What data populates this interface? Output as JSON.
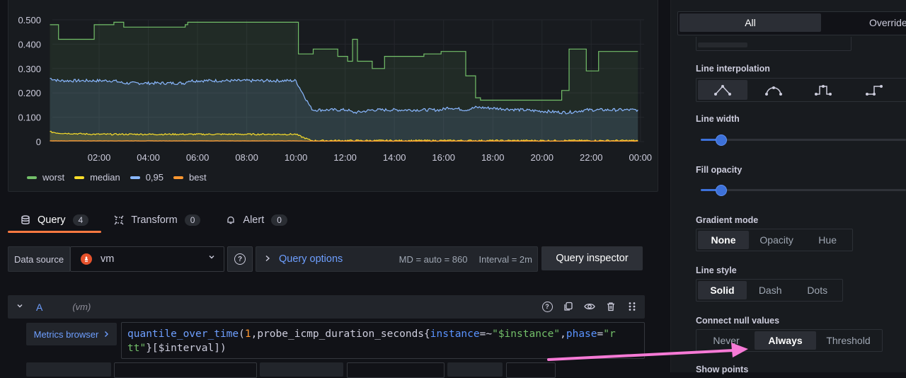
{
  "chart": {
    "legend": [
      {
        "name": "worst",
        "color": "#73bf69"
      },
      {
        "name": "median",
        "color": "#fade2a"
      },
      {
        "name": "0,95",
        "color": "#8ab8ff"
      },
      {
        "name": "best",
        "color": "#ff9830"
      }
    ]
  },
  "chart_data": {
    "type": "line",
    "y_ticks": [
      "0.500",
      "0.400",
      "0.300",
      "0.200",
      "0.100",
      "0"
    ],
    "x_ticks": [
      "02:00",
      "04:00",
      "06:00",
      "08:00",
      "10:00",
      "12:00",
      "14:00",
      "16:00",
      "18:00",
      "20:00",
      "22:00",
      "00:00"
    ],
    "ylim": [
      0,
      0.5
    ],
    "x_hours": [
      0.0,
      0.35,
      1.8,
      2.6,
      3.0,
      5.5,
      5.6,
      7.6,
      10.0,
      10.1,
      10.6,
      10.7,
      11.7,
      12.1,
      12.3,
      12.5,
      13.1,
      13.6,
      14.2,
      14.6,
      15.2,
      15.9,
      16.2,
      16.9,
      17.3,
      17.5,
      20.8,
      21.1,
      21.8,
      22.3,
      23.5,
      23.9
    ],
    "series": [
      {
        "name": "worst",
        "values": [
          0.48,
          0.42,
          0.48,
          0.49,
          0.47,
          0.48,
          0.49,
          0.49,
          0.49,
          0.36,
          0.36,
          0.38,
          0.35,
          0.33,
          0.42,
          0.33,
          0.3,
          0.35,
          0.35,
          0.35,
          0.36,
          0.37,
          0.37,
          0.27,
          0.18,
          0.17,
          0.21,
          0.38,
          0.29,
          0.37,
          0.37,
          0.37
        ]
      },
      {
        "name": "0,95",
        "values": [
          0.26,
          0.25,
          0.25,
          0.25,
          0.24,
          0.24,
          0.25,
          0.25,
          0.25,
          0.23,
          0.14,
          0.13,
          0.13,
          0.13,
          0.12,
          0.12,
          0.13,
          0.13,
          0.13,
          0.13,
          0.13,
          0.13,
          0.14,
          0.13,
          0.14,
          0.14,
          0.12,
          0.12,
          0.13,
          0.13,
          0.13,
          0.13
        ]
      },
      {
        "name": "median",
        "values": [
          0.04,
          0.035,
          0.03,
          0.03,
          0.03,
          0.03,
          0.03,
          0.03,
          0.03,
          0.025,
          0.005,
          0.004,
          0.004,
          0.004,
          0.004,
          0.004,
          0.004,
          0.004,
          0.004,
          0.004,
          0.004,
          0.004,
          0.004,
          0.004,
          0.004,
          0.004,
          0.004,
          0.004,
          0.004,
          0.004,
          0.004,
          0.004
        ]
      },
      {
        "name": "best",
        "values": [
          0.003,
          0.003,
          0.003,
          0.003,
          0.003,
          0.003,
          0.003,
          0.003,
          0.003,
          0.003,
          0.002,
          0.002,
          0.002,
          0.002,
          0.002,
          0.002,
          0.002,
          0.002,
          0.002,
          0.002,
          0.002,
          0.002,
          0.002,
          0.002,
          0.002,
          0.002,
          0.002,
          0.002,
          0.002,
          0.002,
          0.002,
          0.002
        ]
      }
    ]
  },
  "tabs": [
    {
      "label": "Query",
      "count": "4"
    },
    {
      "label": "Transform",
      "count": "0"
    },
    {
      "label": "Alert",
      "count": "0"
    }
  ],
  "datasource": {
    "label": "Data source",
    "value": "vm"
  },
  "query_options": {
    "title": "Query options",
    "md": "MD = auto = 860",
    "interval": "Interval = 2m"
  },
  "query_inspector": "Query inspector",
  "query_a": {
    "letter": "A",
    "ds": "(vm)"
  },
  "metrics_browser": "Metrics browser",
  "code": {
    "fn": "quantile_over_time",
    "p1": "(",
    "num": "1",
    "p2": ",probe_icmp_duration_seconds{",
    "lbl1": "instance",
    "op1": "=~",
    "str1": "\"$instance\"",
    "p3": ",",
    "lbl2": "phase",
    "op2": "=",
    "str2a": "\"r",
    "str2b": "tt\"",
    "p4": "}[$interval])"
  },
  "options_pane": {
    "seg_all": "All",
    "seg_overrides": "Overrides",
    "line_interpolation": "Line interpolation",
    "line_width": "Line width",
    "line_width_value": 1,
    "line_width_max": 10,
    "fill_opacity": "Fill opacity",
    "fill_opacity_value": 10,
    "fill_opacity_max": 100,
    "gradient_mode": "Gradient mode",
    "gradient_options": [
      "None",
      "Opacity",
      "Hue"
    ],
    "line_style": "Line style",
    "line_style_options": [
      "Solid",
      "Dash",
      "Dots"
    ],
    "connect_null": "Connect null values",
    "connect_null_options": [
      "Never",
      "Always",
      "Threshold"
    ],
    "show_points": "Show points"
  },
  "annotation_color": "#f67ad6"
}
